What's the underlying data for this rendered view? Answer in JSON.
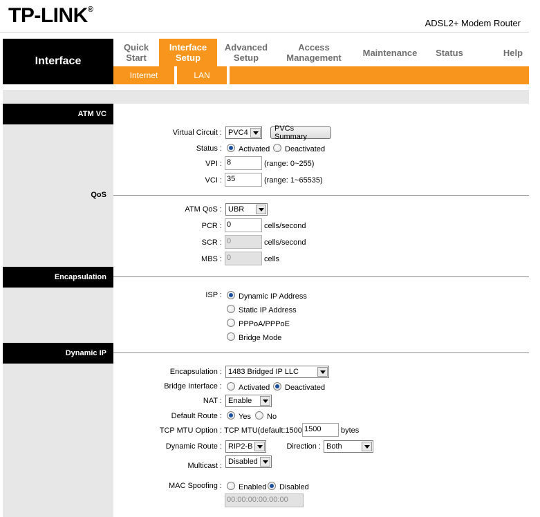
{
  "brand": {
    "logo": "TP-LINK",
    "registered": "®",
    "model": "ADSL2+ Modem Router"
  },
  "nav": {
    "section_title": "Interface",
    "items": [
      {
        "line1": "Quick",
        "line2": "Start"
      },
      {
        "line1": "Interface",
        "line2": "Setup",
        "active": true
      },
      {
        "line1": "Advanced",
        "line2": "Setup"
      },
      {
        "line1": "Access",
        "line2": "Management"
      },
      {
        "line1": "Maintenance",
        "line2": ""
      },
      {
        "line1": "Status",
        "line2": ""
      },
      {
        "line1": "Help",
        "line2": ""
      }
    ],
    "sub_items": [
      "Internet",
      "LAN"
    ],
    "active_color": "#f7951d"
  },
  "atm_vc": {
    "title": "ATM VC",
    "virtual_circuit": {
      "label": "Virtual Circuit :",
      "value": "PVC4",
      "button": "PVCs Summary"
    },
    "status": {
      "label": "Status :",
      "options": [
        "Activated",
        "Deactivated"
      ],
      "selected": "Activated"
    },
    "vpi": {
      "label": "VPI :",
      "value": "8",
      "range": "(range: 0~255)"
    },
    "vci": {
      "label": "VCI :",
      "value": "35",
      "range": "(range: 1~65535)"
    }
  },
  "qos": {
    "title": "QoS",
    "atm_qos": {
      "label": "ATM QoS :",
      "value": "UBR"
    },
    "pcr": {
      "label": "PCR :",
      "value": "0",
      "unit": "cells/second"
    },
    "scr": {
      "label": "SCR :",
      "value": "0",
      "unit": "cells/second"
    },
    "mbs": {
      "label": "MBS :",
      "value": "0",
      "unit": "cells"
    }
  },
  "encapsulation": {
    "title": "Encapsulation",
    "isp": {
      "label": "ISP :",
      "options": [
        "Dynamic IP Address",
        "Static IP Address",
        "PPPoA/PPPoE",
        "Bridge Mode"
      ],
      "selected": "Dynamic IP Address"
    }
  },
  "dynamic_ip": {
    "title": "Dynamic IP",
    "encapsulation": {
      "label": "Encapsulation :",
      "value": "1483 Bridged IP LLC"
    },
    "bridge_interface": {
      "label": "Bridge Interface :",
      "options": [
        "Activated",
        "Deactivated"
      ],
      "selected": "Deactivated"
    },
    "nat": {
      "label": "NAT :",
      "value": "Enable"
    },
    "default_route": {
      "label": "Default Route :",
      "options": [
        "Yes",
        "No"
      ],
      "selected": "Yes"
    },
    "tcp_mtu": {
      "label": "TCP MTU Option :",
      "prefix": "TCP MTU(default:1500)",
      "value": "1500",
      "unit": "bytes"
    },
    "dynamic_route": {
      "label": "Dynamic Route :",
      "value": "RIP2-B",
      "direction_label": "Direction :",
      "direction_value": "Both"
    },
    "multicast": {
      "label": "Multicast :",
      "value": "Disabled"
    },
    "mac_spoofing": {
      "label": "MAC Spoofing :",
      "options": [
        "Enabled",
        "Disabled"
      ],
      "selected": "Disabled",
      "mac_value": "00:00:00:00:00:00"
    }
  }
}
